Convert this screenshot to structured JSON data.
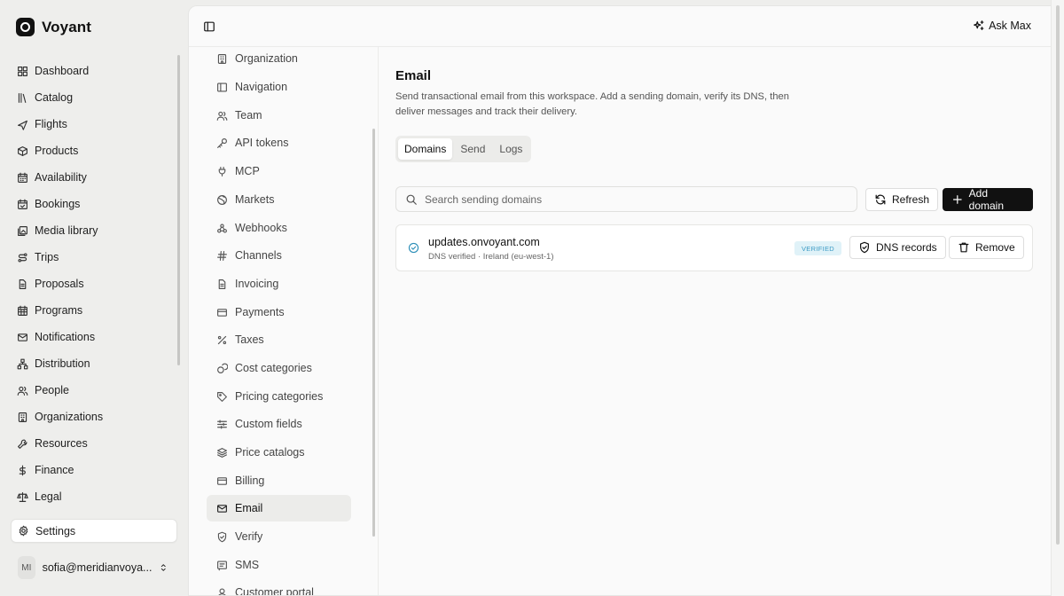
{
  "app": {
    "name": "Voyant"
  },
  "sidebar": {
    "items": [
      {
        "label": "Dashboard",
        "icon": "dashboard-icon"
      },
      {
        "label": "Catalog",
        "icon": "library-icon"
      },
      {
        "label": "Flights",
        "icon": "plane-icon"
      },
      {
        "label": "Products",
        "icon": "package-icon"
      },
      {
        "label": "Availability",
        "icon": "calendar-icon"
      },
      {
        "label": "Bookings",
        "icon": "calendar-check-icon"
      },
      {
        "label": "Media library",
        "icon": "image-icon"
      },
      {
        "label": "Trips",
        "icon": "route-icon"
      },
      {
        "label": "Proposals",
        "icon": "file-text-icon"
      },
      {
        "label": "Programs",
        "icon": "calendar-grid-icon"
      },
      {
        "label": "Notifications",
        "icon": "mail-icon"
      },
      {
        "label": "Distribution",
        "icon": "network-icon"
      },
      {
        "label": "People",
        "icon": "users-icon"
      },
      {
        "label": "Organizations",
        "icon": "building-icon"
      },
      {
        "label": "Resources",
        "icon": "wrench-icon"
      },
      {
        "label": "Finance",
        "icon": "dollar-icon"
      },
      {
        "label": "Legal",
        "icon": "scale-icon"
      }
    ],
    "settings": {
      "label": "Settings",
      "icon": "gear-icon"
    },
    "user": {
      "initials": "MI",
      "email": "sofia@meridianvoya..."
    }
  },
  "topbar": {
    "ask_label": "Ask Max"
  },
  "subnav": {
    "items": [
      {
        "label": "Organization",
        "icon": "building-icon"
      },
      {
        "label": "Navigation",
        "icon": "panel-icon"
      },
      {
        "label": "Team",
        "icon": "users-icon"
      },
      {
        "label": "API tokens",
        "icon": "key-icon"
      },
      {
        "label": "MCP",
        "icon": "plug-icon"
      },
      {
        "label": "Markets",
        "icon": "globe-icon"
      },
      {
        "label": "Webhooks",
        "icon": "webhook-icon"
      },
      {
        "label": "Channels",
        "icon": "hash-icon"
      },
      {
        "label": "Invoicing",
        "icon": "receipt-icon"
      },
      {
        "label": "Payments",
        "icon": "credit-card-icon"
      },
      {
        "label": "Taxes",
        "icon": "percent-icon"
      },
      {
        "label": "Cost categories",
        "icon": "coins-icon"
      },
      {
        "label": "Pricing categories",
        "icon": "tag-icon"
      },
      {
        "label": "Custom fields",
        "icon": "sliders-icon"
      },
      {
        "label": "Price catalogs",
        "icon": "layers-icon"
      },
      {
        "label": "Billing",
        "icon": "credit-card-icon"
      },
      {
        "label": "Email",
        "icon": "mail-icon"
      },
      {
        "label": "Verify",
        "icon": "shield-check-icon"
      },
      {
        "label": "SMS",
        "icon": "message-icon"
      },
      {
        "label": "Customer portal",
        "icon": "user-icon"
      }
    ],
    "active": "Email"
  },
  "main": {
    "title": "Email",
    "description": "Send transactional email from this workspace. Add a sending domain, verify its DNS, then deliver messages and track their delivery.",
    "tabs": [
      {
        "label": "Domains",
        "active": true
      },
      {
        "label": "Send",
        "active": false
      },
      {
        "label": "Logs",
        "active": false
      }
    ],
    "search_placeholder": "Search sending domains",
    "refresh_label": "Refresh",
    "add_label": "Add domain",
    "domains": [
      {
        "name": "updates.onvoyant.com",
        "detail": "DNS verified · Ireland (eu-west-1)",
        "status": "VERIFIED",
        "dns_label": "DNS records",
        "remove_label": "Remove"
      }
    ]
  },
  "colors": {
    "accent": "#111111",
    "verified_bg": "#e0f2f8",
    "verified_text": "#3a9ac4"
  }
}
